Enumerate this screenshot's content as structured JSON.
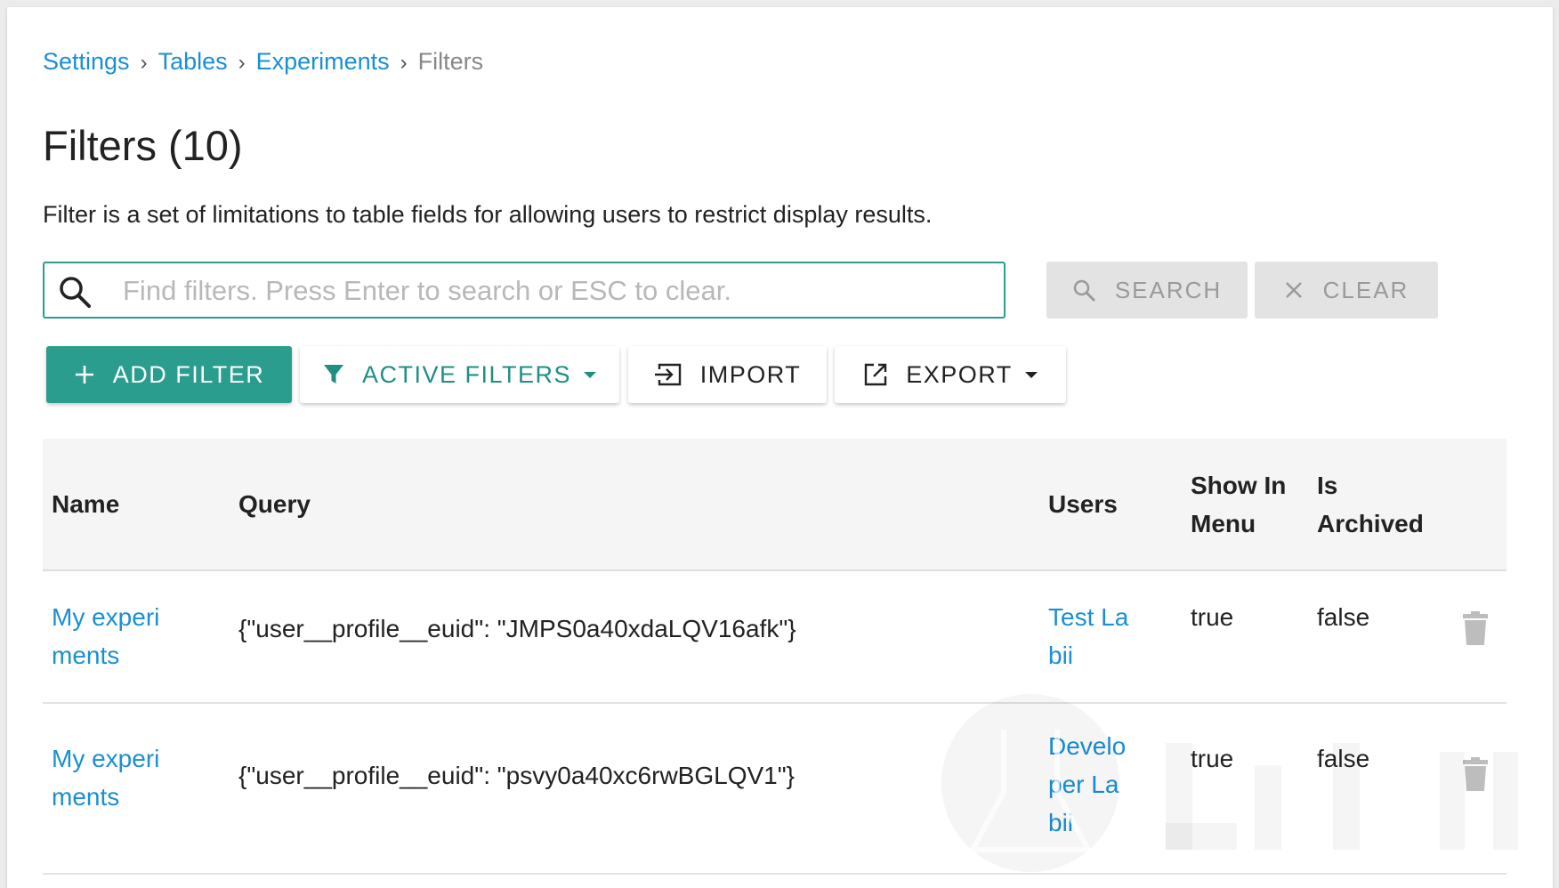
{
  "breadcrumb": {
    "items": [
      "Settings",
      "Tables",
      "Experiments"
    ],
    "current": "Filters",
    "separator": "›"
  },
  "page": {
    "title": "Filters (10)",
    "description": "Filter is a set of limitations to table fields for allowing users to restrict display results."
  },
  "search": {
    "placeholder": "Find filters. Press Enter to search or ESC to clear.",
    "value": "",
    "search_label": "SEARCH",
    "clear_label": "CLEAR"
  },
  "toolbar": {
    "add_label": "ADD FILTER",
    "active_filters_label": "ACTIVE FILTERS",
    "import_label": "IMPORT",
    "export_label": "EXPORT"
  },
  "table": {
    "headers": {
      "name": "Name",
      "query": "Query",
      "users": "Users",
      "show_in_menu_1": "Show In",
      "show_in_menu_2": "Menu",
      "is_archived_1": "Is",
      "is_archived_2": "Archived"
    },
    "rows": [
      {
        "name_lines": [
          "My experi",
          "ments"
        ],
        "query": "{\"user__profile__euid\": \"JMPS0a40xdaLQV16afk\"}",
        "users_lines": [
          "Test La",
          "bii"
        ],
        "show_in_menu": "true",
        "is_archived": "false"
      },
      {
        "name_lines": [
          "My experi",
          "ments"
        ],
        "query": "{\"user__profile__euid\": \"psvy0a40xc6rwBGLQV1\"}",
        "users_lines": [
          "Develo",
          "per La",
          "bii"
        ],
        "show_in_menu": "true",
        "is_archived": "false"
      }
    ]
  },
  "colors": {
    "accent": "#2a9d8f",
    "link": "#1a8fd4",
    "muted": "#888888"
  },
  "icons": {
    "search": "search-icon",
    "clear": "close-icon",
    "add": "plus-icon",
    "filter": "filter-icon",
    "import": "import-icon",
    "export": "export-icon",
    "delete": "trash-icon"
  }
}
